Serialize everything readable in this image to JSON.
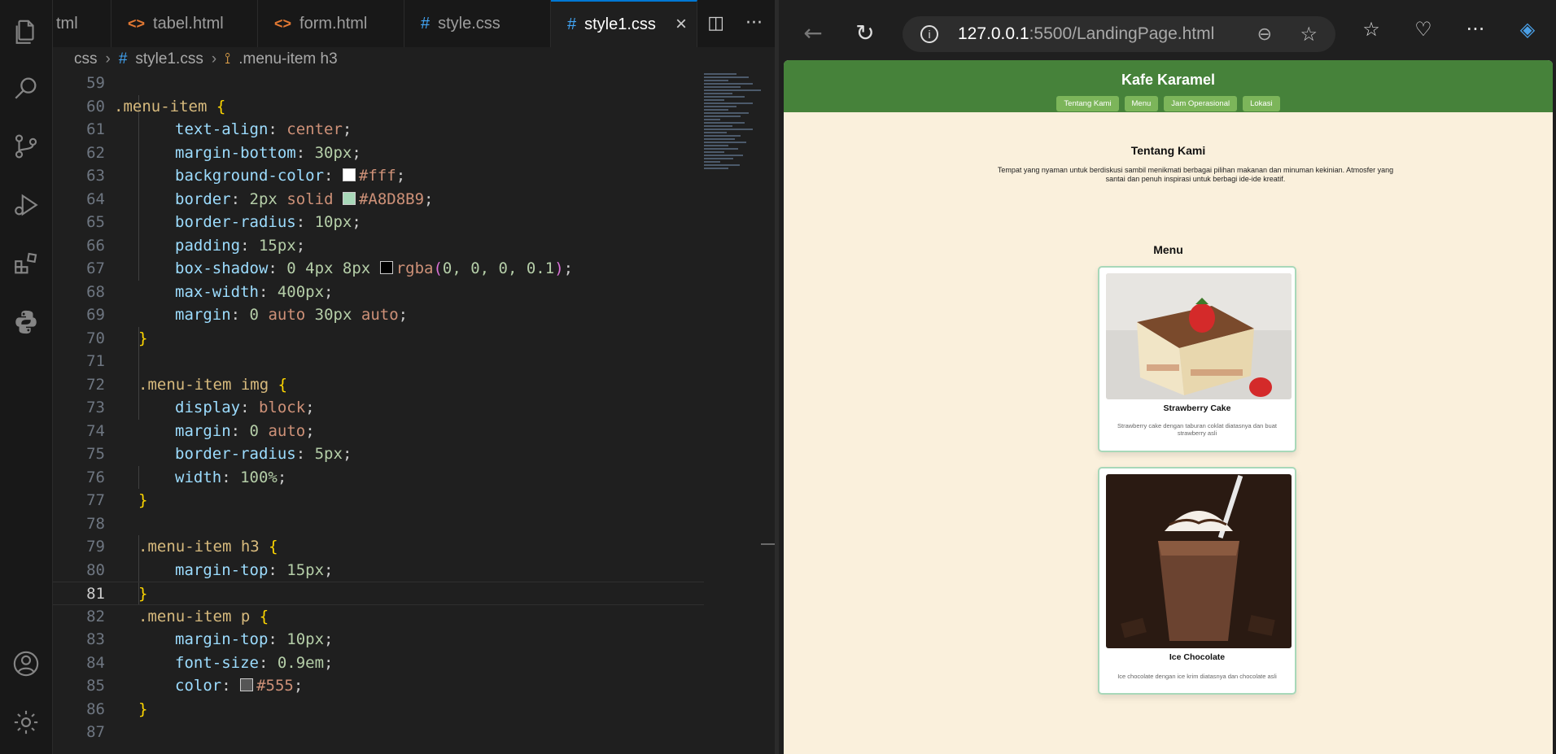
{
  "editor": {
    "tabs": [
      {
        "label": "tml",
        "kind": "html"
      },
      {
        "label": "tabel.html",
        "kind": "html"
      },
      {
        "label": "form.html",
        "kind": "html"
      },
      {
        "label": "style.css",
        "kind": "css"
      },
      {
        "label": "style1.css",
        "kind": "css",
        "active": true
      }
    ],
    "breadcrumb": {
      "folder": "css",
      "file": "style1.css",
      "symbol": ".menu-item h3"
    },
    "current_line": 81,
    "line_numbers": [
      "59",
      "60",
      "61",
      "62",
      "63",
      "64",
      "65",
      "66",
      "67",
      "68",
      "69",
      "70",
      "71",
      "72",
      "73",
      "74",
      "75",
      "76",
      "77",
      "78",
      "79",
      "80",
      "81",
      "82",
      "83",
      "84",
      "85",
      "86",
      "87"
    ],
    "code": {
      "l60": ".menu-item",
      "l61_p": "text-align",
      "l61_v": "center",
      "l62_p": "margin-bottom",
      "l62_v": "30px",
      "l63_p": "background-color",
      "l63_v": "#fff",
      "l64_p": "border",
      "l64_v1": "2px",
      "l64_v2": "solid",
      "l64_v3": "#A8D8B9",
      "l65_p": "border-radius",
      "l65_v": "10px",
      "l66_p": "padding",
      "l66_v": "15px",
      "l67_p": "box-shadow",
      "l67_v1": "0 4px 8px",
      "l67_fn": "rgba",
      "l67_args": "0, 0, 0, 0.1",
      "l68_p": "max-width",
      "l68_v": "400px",
      "l69_p": "margin",
      "l69_v1": "0",
      "l69_v2": "auto",
      "l69_v3": "30px",
      "l69_v4": "auto",
      "l72": ".menu-item img",
      "l73_p": "display",
      "l73_v": "block",
      "l74_p": "margin",
      "l74_v1": "0",
      "l74_v2": "auto",
      "l75_p": "border-radius",
      "l75_v": "5px",
      "l76_p": "width",
      "l76_v": "100%",
      "l79": ".menu-item h3",
      "l80_p": "margin-top",
      "l80_v": "15px",
      "l82": ".menu-item p",
      "l83_p": "margin-top",
      "l83_v": "10px",
      "l84_p": "font-size",
      "l84_v": "0.9em",
      "l85_p": "color",
      "l85_v": "#555"
    }
  },
  "browser": {
    "url_host": "127.0.0.1",
    "url_path": ":5500/LandingPage.html",
    "page": {
      "site_title": "Kafe Karamel",
      "nav": [
        "Tentang Kami",
        "Menu",
        "Jam Operasional",
        "Lokasi"
      ],
      "about_title": "Tentang Kami",
      "about_text": "Tempat yang nyaman untuk berdiskusi sambil menikmati berbagai pilihan makanan dan minuman kekinian. Atmosfer yang santai dan penuh inspirasi untuk berbagi ide-ide kreatif.",
      "menu_title": "Menu",
      "items": [
        {
          "name": "Strawberry Cake",
          "desc": "Strawberry cake dengan taburan coklat diatasnya dan buat strawberry asli"
        },
        {
          "name": "Ice Chocolate",
          "desc": "Ice chocolate dengan ice krim diatasnya dan chocolate asli"
        }
      ]
    }
  },
  "colors": {
    "header_green": "#46823a",
    "nav_green": "#7cb55a",
    "page_bg": "#faf0dc",
    "card_border": "#A8D8B9",
    "accent_blue": "#0078d4"
  }
}
